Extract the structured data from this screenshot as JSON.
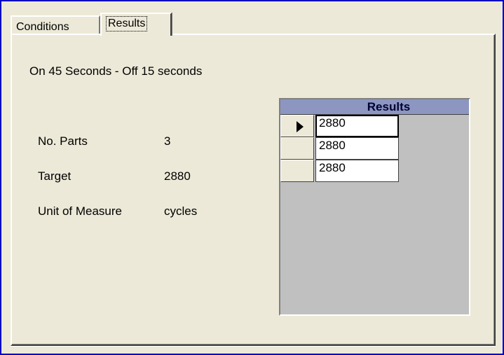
{
  "tabs": [
    {
      "label": "Conditions"
    },
    {
      "label": "Results"
    }
  ],
  "description": "On 45 Seconds - Off 15 seconds",
  "fields": [
    {
      "label": "No. Parts",
      "value": "3"
    },
    {
      "label": "Target",
      "value": "2880"
    },
    {
      "label": "Unit of Measure",
      "value": "cycles"
    }
  ],
  "grid": {
    "header": "Results",
    "rows": [
      "2880",
      "2880",
      "2880"
    ]
  },
  "colors": {
    "window_border": "#0000c0",
    "background": "#ece9d8",
    "grid_header": "#8c96c0",
    "grid_empty": "#c0c0c0"
  }
}
